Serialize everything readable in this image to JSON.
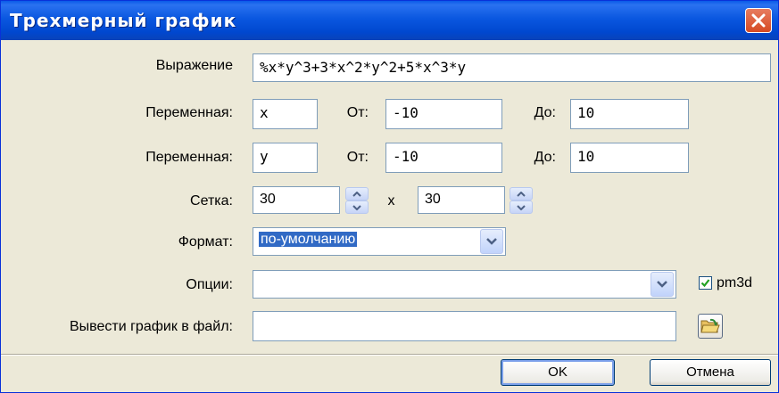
{
  "window": {
    "title": "Трехмерный график"
  },
  "expression": {
    "label": "Выражение",
    "value": "%x*y^3+3*x^2*y^2+5*x^3*y"
  },
  "var1": {
    "label": "Переменная:",
    "name": "x",
    "from_label": "От:",
    "from": "-10",
    "to_label": "До:",
    "to": "10"
  },
  "var2": {
    "label": "Переменная:",
    "name": "y",
    "from_label": "От:",
    "from": "-10",
    "to_label": "До:",
    "to": "10"
  },
  "grid": {
    "label": "Сетка:",
    "x": "30",
    "sep": "x",
    "y": "30"
  },
  "format": {
    "label": "Формат:",
    "value": "по-умолчанию"
  },
  "options": {
    "label": "Опции:",
    "value": "",
    "pm3d_label": "pm3d",
    "pm3d_checked": true
  },
  "output": {
    "label": "Вывести график в файл:",
    "value": ""
  },
  "buttons": {
    "ok": "OK",
    "cancel": "Отмена"
  },
  "colors": {
    "titlebar": "#0a57e0",
    "selection": "#316ac5",
    "close": "#d64a23"
  }
}
